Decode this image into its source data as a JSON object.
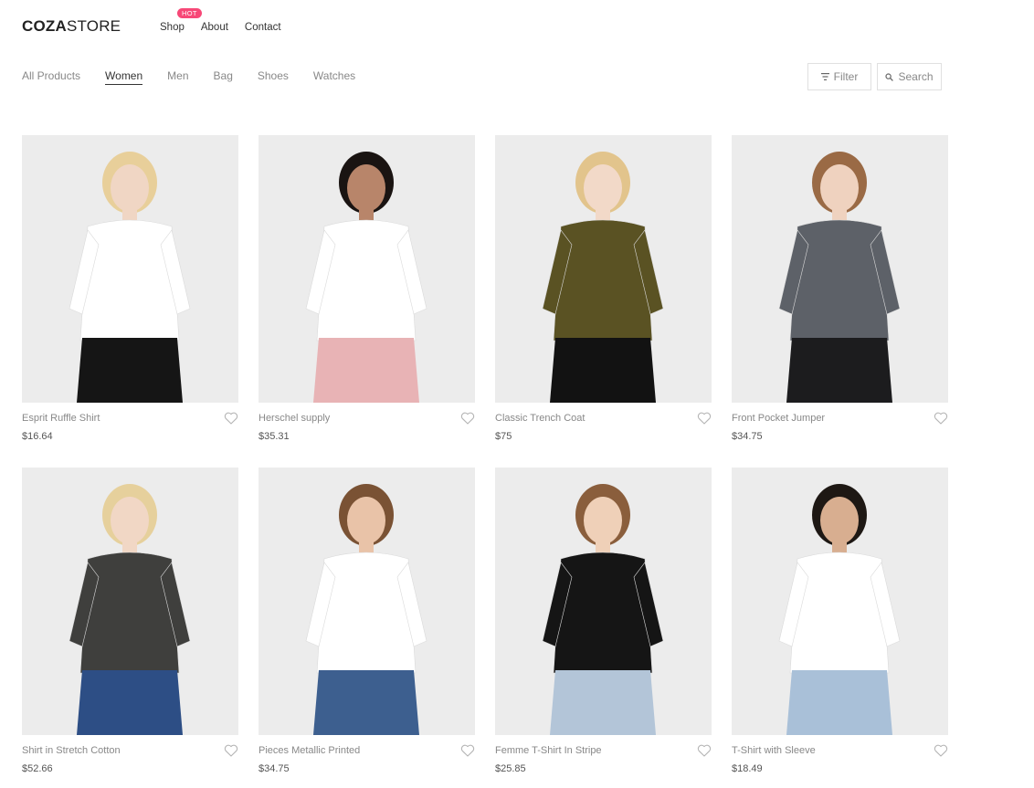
{
  "brand": {
    "bold": "COZA",
    "light": "STORE"
  },
  "nav": {
    "items": [
      {
        "label": "Shop",
        "badge": "HOT"
      },
      {
        "label": "About"
      },
      {
        "label": "Contact"
      }
    ]
  },
  "filters": [
    "All Products",
    "Women",
    "Men",
    "Bag",
    "Shoes",
    "Watches"
  ],
  "active_filter": "Women",
  "tools": {
    "filter_label": "Filter",
    "search_label": "Search"
  },
  "products": [
    {
      "name": "Esprit Ruffle Shirt",
      "price": "$16.64",
      "top": "white t-shirt",
      "bottom": "black jeans"
    },
    {
      "name": "Herschel supply",
      "price": "$35.31",
      "top": "white shirt",
      "bottom": "pink trousers"
    },
    {
      "name": "Classic Trench Coat",
      "price": "$75",
      "top": "olive coat",
      "bottom": "black trousers"
    },
    {
      "name": "Front Pocket Jumper",
      "price": "$34.75",
      "top": "grey denim shirt",
      "bottom": "black skirt"
    },
    {
      "name": "Shirt in Stretch Cotton",
      "price": "$52.66",
      "top": "tweed blazer",
      "bottom": "blue jeans"
    },
    {
      "name": "Pieces Metallic Printed",
      "price": "$34.75",
      "top": "cactus print tee",
      "bottom": "denim"
    },
    {
      "name": "Femme T-Shirt In Stripe",
      "price": "$25.85",
      "top": "black crop top",
      "bottom": "light jeans"
    },
    {
      "name": "T-Shirt with Sleeve",
      "price": "$18.49",
      "top": "white tee",
      "bottom": "light jeans"
    }
  ],
  "colors": {
    "accent_hot": "#f74877",
    "muted_text": "#888888",
    "image_bg": "#ededed"
  }
}
